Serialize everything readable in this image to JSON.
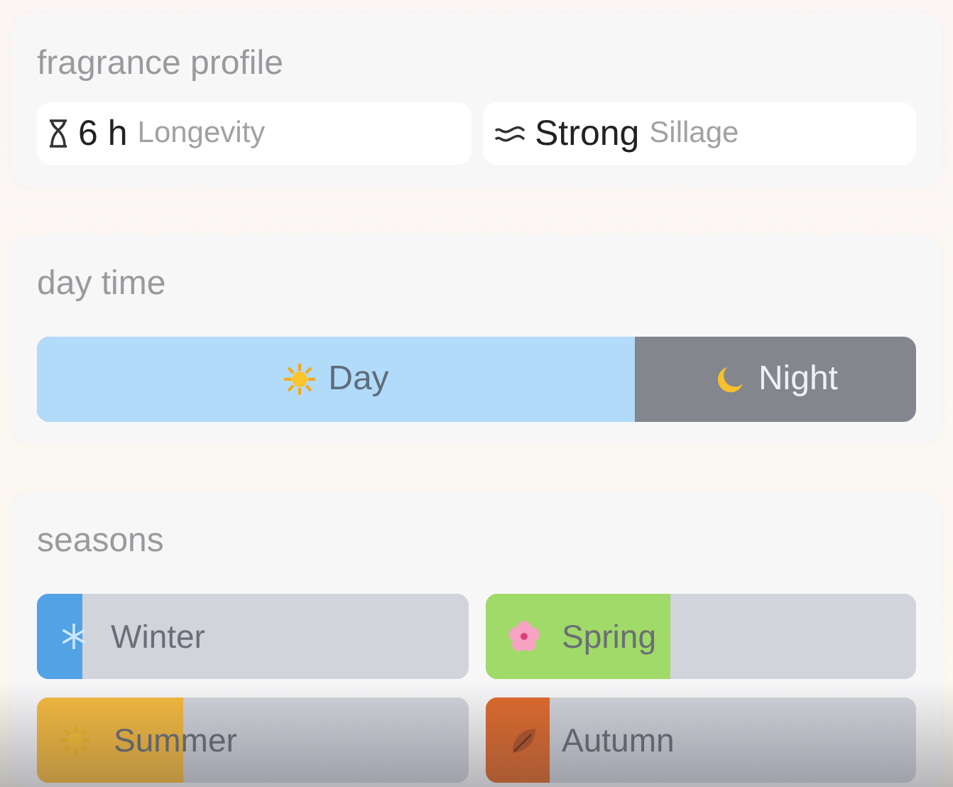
{
  "profile": {
    "title": "fragrance profile",
    "stats": [
      {
        "kind": "hourglass",
        "value": "6 h",
        "label": "Longevity"
      },
      {
        "kind": "waves",
        "value": "Strong",
        "label": "Sillage"
      }
    ]
  },
  "day_time": {
    "title": "day time",
    "level": 0.68,
    "day": {
      "label": "Day"
    },
    "night": {
      "label": "Night"
    }
  },
  "seasons": {
    "title": "seasons",
    "items": [
      {
        "kind": "winter",
        "label": "Winter",
        "level": 0.105,
        "color": "#52a2e6"
      },
      {
        "kind": "spring",
        "label": "Spring",
        "level": 0.43,
        "color": "#a0da68"
      },
      {
        "kind": "summer",
        "label": "Summer",
        "level": 0.34,
        "color": "#f6bb3e"
      },
      {
        "kind": "autumn",
        "label": "Autumn",
        "level": 0.15,
        "color": "#e06a2c"
      }
    ]
  }
}
